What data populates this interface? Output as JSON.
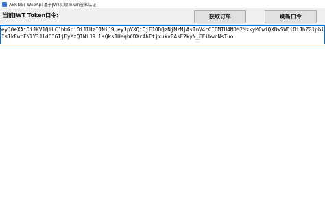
{
  "window": {
    "title": "ASP.NET WebApi 基于JWT实现Token签名认证",
    "icon": "app-icon"
  },
  "toolbar": {
    "token_label": "当前JWT Token口令:",
    "get_orders_label": "获取订单",
    "refresh_token_label": "刷新口令"
  },
  "token": {
    "value": "eyJ0eXAiOiJKV1QiLCJhbGciOiJIUzI1NiJ9.eyJpYXQiOjE1ODQzNjMzMjAsImV4cCI6MTU4NDM2MzkyMCwiQXBwSWQiOiJhZG1pbiIsIkFwcFNlY3JldCI6IjEyMzQ1NiJ9.lsQks1HeqhCDXr4hFtjxukv0AsE2kyN_EFibwcNsTuo"
  }
}
